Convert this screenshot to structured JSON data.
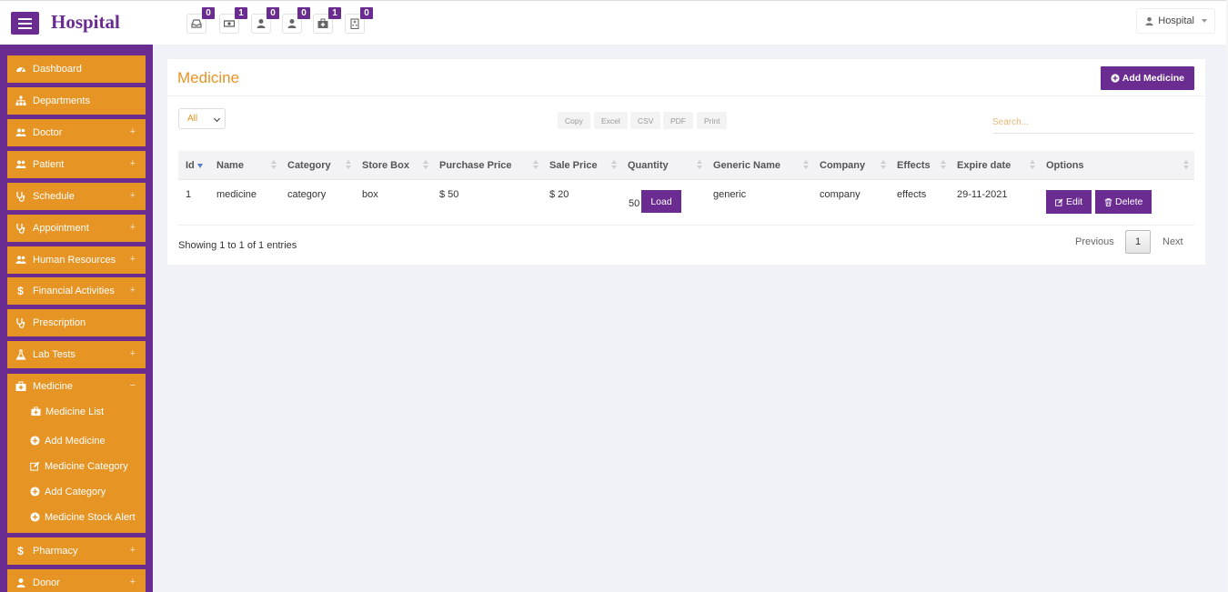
{
  "app": {
    "title": "Hospital"
  },
  "header": {
    "notifications": [
      {
        "icon": "inbox-icon",
        "count": "0"
      },
      {
        "icon": "money-icon",
        "count": "1"
      },
      {
        "icon": "user-icon",
        "count": "0"
      },
      {
        "icon": "user-icon",
        "count": "0"
      },
      {
        "icon": "medkit-icon",
        "count": "1"
      },
      {
        "icon": "hospital-building-icon",
        "count": "0"
      }
    ],
    "user_label": "Hospital"
  },
  "sidebar": {
    "items": [
      {
        "label": "Dashboard",
        "icon": "dashboard-icon",
        "expandable": false
      },
      {
        "label": "Departments",
        "icon": "sitemap-icon",
        "expandable": false
      },
      {
        "label": "Doctor",
        "icon": "users-icon",
        "expandable": true,
        "toggle": "+"
      },
      {
        "label": "Patient",
        "icon": "users-icon",
        "expandable": true,
        "toggle": "+"
      },
      {
        "label": "Schedule",
        "icon": "stethoscope-icon",
        "expandable": true,
        "toggle": "+"
      },
      {
        "label": "Appointment",
        "icon": "stethoscope-icon",
        "expandable": true,
        "toggle": "+"
      },
      {
        "label": "Human Resources",
        "icon": "users-icon",
        "expandable": true,
        "toggle": "+"
      },
      {
        "label": "Financial Activities",
        "icon": "dollar-icon",
        "expandable": true,
        "toggle": "+"
      },
      {
        "label": "Prescription",
        "icon": "stethoscope-icon",
        "expandable": false
      },
      {
        "label": "Lab Tests",
        "icon": "flask-icon",
        "expandable": true,
        "toggle": "+"
      },
      {
        "label": "Medicine",
        "icon": "medkit-icon",
        "expandable": true,
        "toggle": "−"
      },
      {
        "label": "Pharmacy",
        "icon": "dollar-icon",
        "expandable": true,
        "toggle": "+"
      },
      {
        "label": "Donor",
        "icon": "user-icon",
        "expandable": true,
        "toggle": "+"
      }
    ],
    "medicine_sub": [
      {
        "label": "Medicine List",
        "icon": "medkit-icon"
      },
      {
        "label": "Add Medicine",
        "icon": "plus-circle-icon"
      },
      {
        "label": "Medicine Category",
        "icon": "edit-icon"
      },
      {
        "label": "Add Category",
        "icon": "plus-circle-icon"
      },
      {
        "label": "Medicine Stock Alert",
        "icon": "plus-circle-icon"
      }
    ]
  },
  "main": {
    "title": "Medicine",
    "add_button": "Add Medicine",
    "length_select": "All",
    "export_buttons": [
      "Copy",
      "Excel",
      "CSV",
      "PDF",
      "Print"
    ],
    "search_placeholder": "Search...",
    "columns": [
      "Id",
      "Name",
      "Category",
      "Store Box",
      "Purchase Price",
      "Sale Price",
      "Quantity",
      "Generic Name",
      "Company",
      "Effects",
      "Expire date",
      "Options"
    ],
    "rows": [
      {
        "id": "1",
        "name": "medicine",
        "category": "category",
        "store_box": "box",
        "purchase_price": "$ 50",
        "sale_price": "$ 20",
        "quantity": "50",
        "load_label": "Load",
        "generic_name": "generic",
        "company": "company",
        "effects": "effects",
        "expire_date": "29-11-2021",
        "edit_label": "Edit",
        "delete_label": "Delete"
      }
    ],
    "info": "Showing 1 to 1 of 1 entries",
    "pagination": {
      "previous": "Previous",
      "current": "1",
      "next": "Next"
    }
  },
  "colors": {
    "primary": "#6a2c91",
    "accent": "#e69424",
    "background": "#f1f2f7"
  }
}
